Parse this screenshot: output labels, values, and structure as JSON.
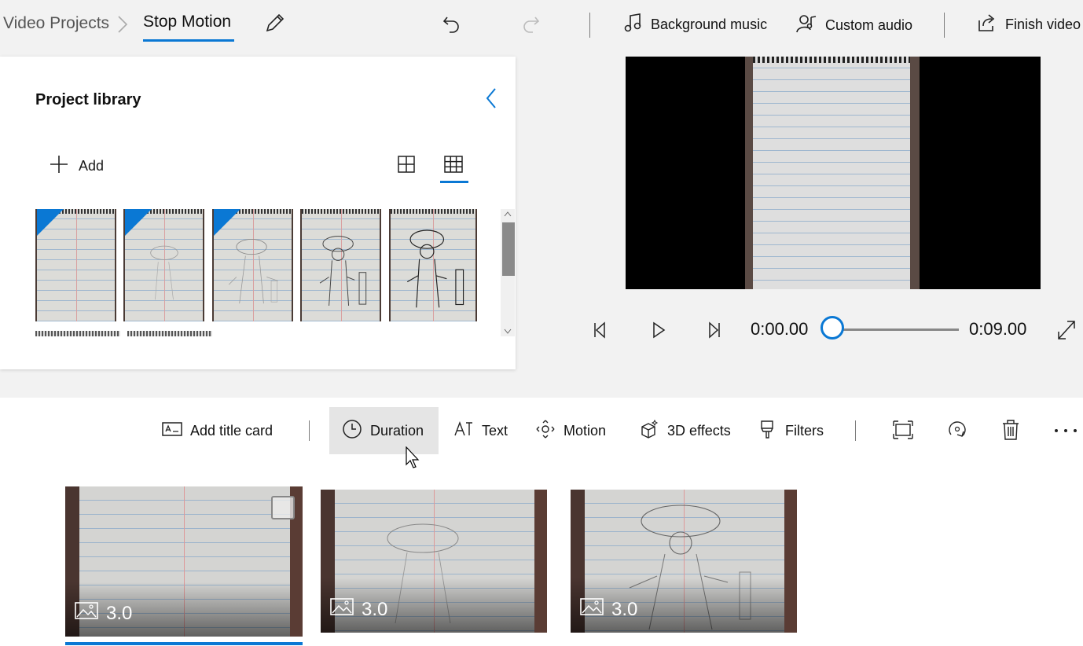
{
  "breadcrumb": {
    "root": "Video Projects",
    "current": "Stop Motion"
  },
  "topbar": {
    "background_music": "Background music",
    "custom_audio": "Custom audio",
    "finish_video": "Finish video"
  },
  "library": {
    "title": "Project library",
    "add_label": "Add",
    "thumbnail_count": 5
  },
  "player": {
    "current_time": "0:00.00",
    "total_time": "0:09.00",
    "progress": 0
  },
  "toolbar": {
    "add_title_card": "Add title card",
    "duration": "Duration",
    "text": "Text",
    "motion": "Motion",
    "effects_3d": "3D effects",
    "filters": "Filters"
  },
  "storyboard": {
    "clips": [
      {
        "duration": "3.0",
        "selected": true
      },
      {
        "duration": "3.0",
        "selected": false
      },
      {
        "duration": "3.0",
        "selected": false
      }
    ]
  },
  "colors": {
    "accent": "#0a78d4"
  }
}
